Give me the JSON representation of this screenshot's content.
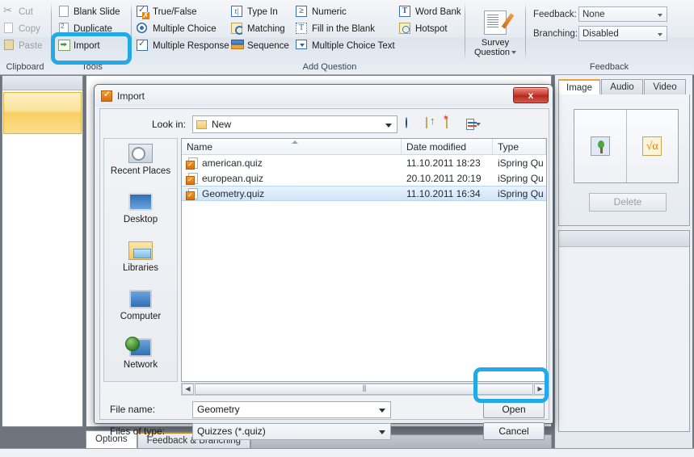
{
  "ribbon": {
    "clipboard": {
      "group_label": "Clipboard",
      "items": [
        {
          "label": "Cut",
          "icon": "scissors-icon",
          "enabled": false
        },
        {
          "label": "Copy",
          "icon": "copy-icon",
          "enabled": false
        },
        {
          "label": "Paste",
          "icon": "paste-icon",
          "enabled": false
        }
      ]
    },
    "tools": {
      "group_label": "Tools",
      "items": [
        {
          "label": "Blank Slide",
          "icon": "blank-slide-icon"
        },
        {
          "label": "Duplicate",
          "icon": "duplicate-icon"
        },
        {
          "label": "Import",
          "icon": "import-icon"
        }
      ]
    },
    "add_question": {
      "group_label": "Add Question",
      "col1": [
        {
          "label": "True/False",
          "icon": "true-false-icon"
        },
        {
          "label": "Multiple Choice",
          "icon": "radio-button-icon"
        },
        {
          "label": "Multiple Response",
          "icon": "checkbox-icon"
        }
      ],
      "col2": [
        {
          "label": "Type In",
          "icon": "type-in-icon"
        },
        {
          "label": "Matching",
          "icon": "matching-icon"
        },
        {
          "label": "Sequence",
          "icon": "sequence-icon"
        }
      ],
      "col3": [
        {
          "label": "Numeric",
          "icon": "numeric-icon"
        },
        {
          "label": "Fill in the Blank",
          "icon": "fill-blank-icon"
        },
        {
          "label": "Multiple Choice Text",
          "icon": "multiple-choice-text-icon"
        }
      ],
      "col4": [
        {
          "label": "Word Bank",
          "icon": "word-bank-icon"
        },
        {
          "label": "Hotspot",
          "icon": "hotspot-icon"
        }
      ],
      "survey": {
        "label_line1": "Survey",
        "label_line2": "Question",
        "icon": "survey-question-icon"
      }
    },
    "feedback": {
      "group_label": "Feedback",
      "feedback_label": "Feedback:",
      "feedback_value": "None",
      "branching_label": "Branching:",
      "branching_value": "Disabled"
    }
  },
  "right_panel": {
    "tabs": [
      {
        "label": "Image",
        "active": true
      },
      {
        "label": "Audio",
        "active": false
      },
      {
        "label": "Video",
        "active": false
      }
    ],
    "media_buttons": [
      {
        "icon": "picture-tree-icon"
      },
      {
        "icon": "equation-icon",
        "glyph": "√α"
      }
    ],
    "delete_label": "Delete"
  },
  "bottom_tabs": [
    {
      "label": "Options",
      "active": true
    },
    {
      "label": "Feedback & Branching",
      "active": false
    }
  ],
  "dialog": {
    "title": "Import",
    "title_icon": "quiz-app-icon",
    "close_label": "x",
    "lookin_label": "Look in:",
    "lookin_value": "New",
    "lookin_icon": "folder-icon",
    "nav_icons": [
      {
        "name": "back-icon"
      },
      {
        "name": "up-one-level-icon"
      },
      {
        "name": "new-folder-icon"
      },
      {
        "name": "views-icon"
      }
    ],
    "places": [
      {
        "label": "Recent Places",
        "icon": "recent-places-icon"
      },
      {
        "label": "Desktop",
        "icon": "desktop-icon"
      },
      {
        "label": "Libraries",
        "icon": "libraries-icon"
      },
      {
        "label": "Computer",
        "icon": "computer-icon"
      },
      {
        "label": "Network",
        "icon": "network-icon"
      }
    ],
    "columns": [
      "Name",
      "Date modified",
      "Type"
    ],
    "files": [
      {
        "name": "american.quiz",
        "modified": "11.10.2011 18:23",
        "type": "iSpring Qu",
        "selected": false
      },
      {
        "name": "european.quiz",
        "modified": "20.10.2011 20:19",
        "type": "iSpring Qu",
        "selected": false
      },
      {
        "name": "Geometry.quiz",
        "modified": "11.10.2011 16:34",
        "type": "iSpring Qu",
        "selected": true
      }
    ],
    "filename_label": "File name:",
    "filename_value": "Geometry",
    "filetype_label": "Files of type:",
    "filetype_value": "Quizzes (*.quiz)",
    "open_label": "Open",
    "cancel_label": "Cancel",
    "scroll_left": "◀",
    "scroll_right": "▶"
  },
  "highlight_color": "#23a8e8"
}
